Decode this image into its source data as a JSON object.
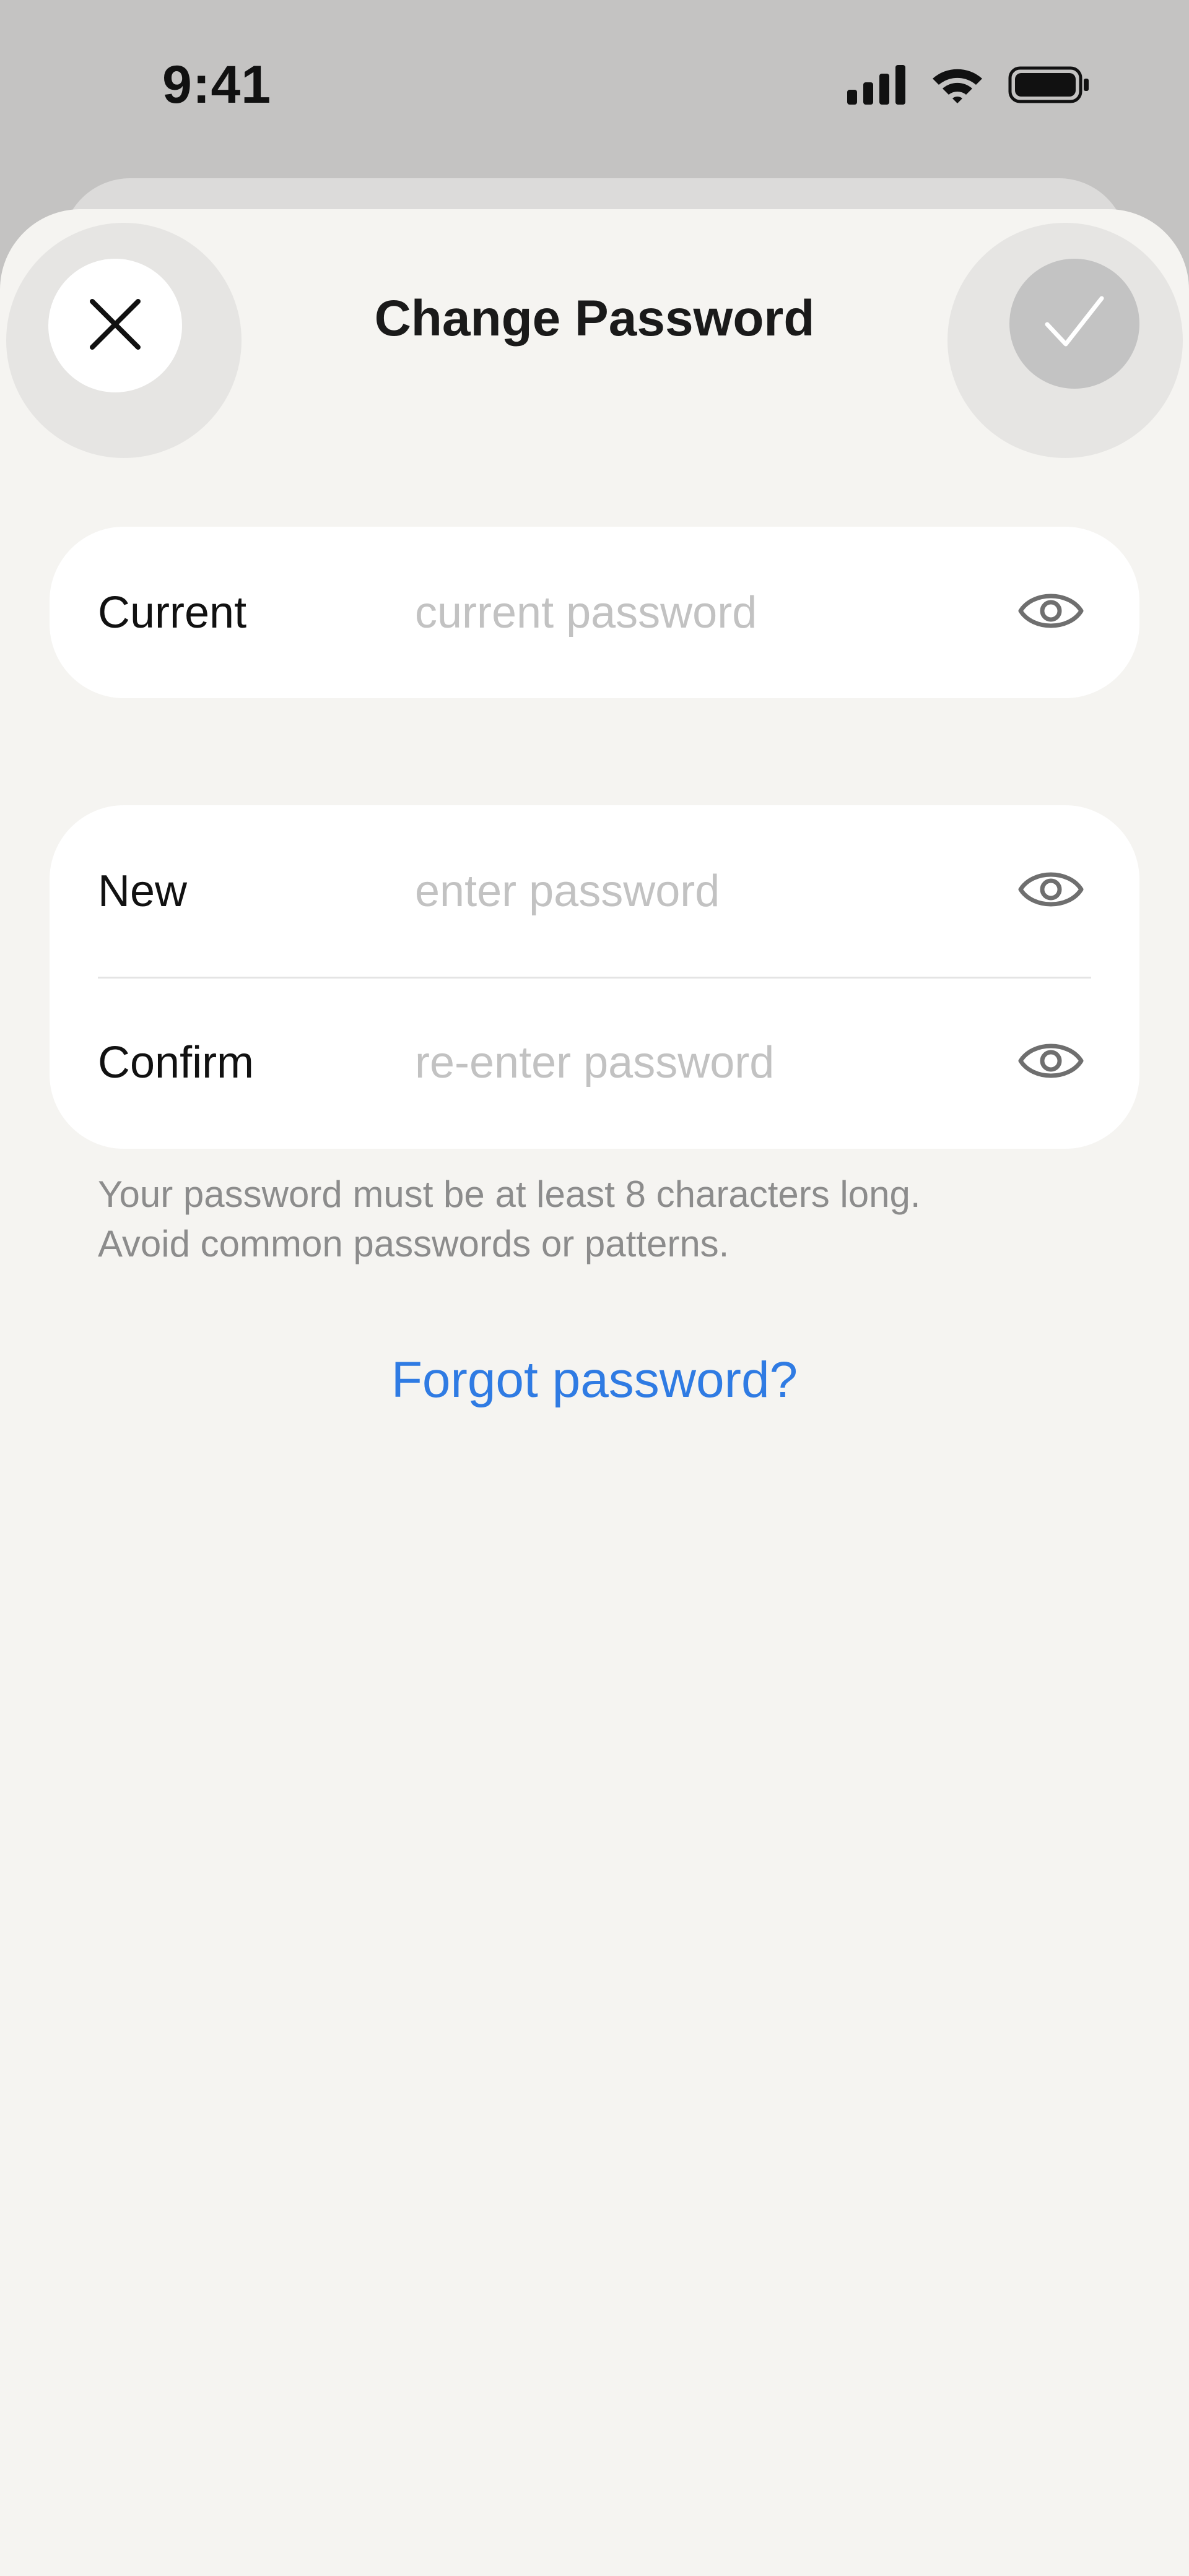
{
  "status_bar": {
    "time": "9:41",
    "icons": [
      "cellular-signal-icon",
      "wifi-icon",
      "battery-icon"
    ]
  },
  "header": {
    "title": "Change Password",
    "close_icon": "close-icon",
    "confirm_icon": "checkmark-icon"
  },
  "current_card": {
    "label": "Current",
    "placeholder": "current password",
    "value": "",
    "toggle_icon": "eye-icon"
  },
  "new_card": {
    "new_label": "New",
    "new_placeholder": "enter password",
    "new_value": "",
    "confirm_label": "Confirm",
    "confirm_placeholder": "re-enter password",
    "confirm_value": "",
    "toggle_icon": "eye-icon"
  },
  "hint": {
    "line1": "Your password must be at least 8 characters long.",
    "line2": "Avoid common passwords or patterns."
  },
  "forgot_link": "Forgot password?",
  "colors": {
    "background_dim": "#c4c3c2",
    "sheet": "#f5f4f1",
    "card": "#ffffff",
    "link": "#2f7be3",
    "placeholder": "#c2c2c2",
    "hint_text": "#8c8c8c",
    "confirm_disabled": "#c3c3c3"
  }
}
